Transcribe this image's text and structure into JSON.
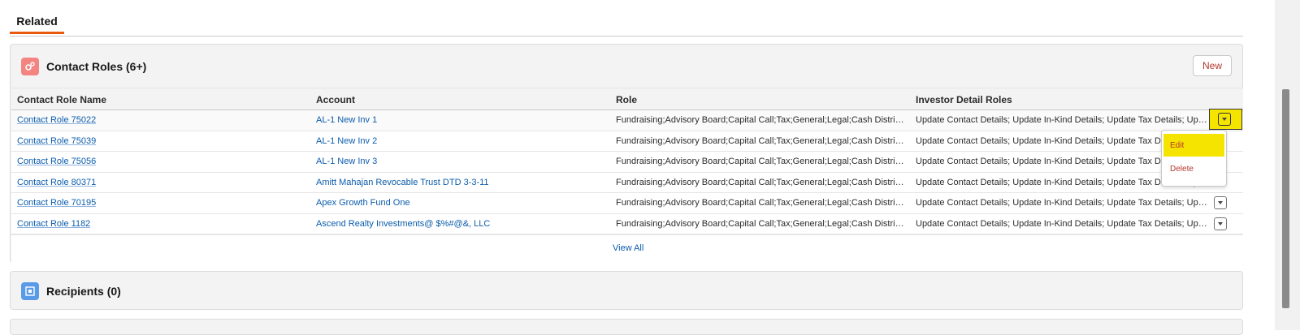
{
  "tabs": {
    "related": "Related"
  },
  "contact_roles": {
    "title": "Contact Roles (6+)",
    "icon": "contact-roles-icon",
    "new_label": "New",
    "columns": [
      "Contact Role Name",
      "Account",
      "Role",
      "Investor Detail Roles"
    ],
    "rows": [
      {
        "name": "Contact Role 75022",
        "account": "AL-1 New Inv 1",
        "role": "Fundraising;Advisory Board;Capital Call;Tax;General;Legal;Cash Distributio...",
        "investor": "Update Contact Details; Update In-Kind Details; Update Tax Details; Updat..."
      },
      {
        "name": "Contact Role 75039",
        "account": "AL-1 New Inv 2",
        "role": "Fundraising;Advisory Board;Capital Call;Tax;General;Legal;Cash Distributio...",
        "investor": "Update Contact Details; Update In-Kind Details; Update Tax Details; Updat..."
      },
      {
        "name": "Contact Role 75056",
        "account": "AL-1 New Inv 3",
        "role": "Fundraising;Advisory Board;Capital Call;Tax;General;Legal;Cash Distributio...",
        "investor": "Update Contact Details; Update In-Kind Details; Update Tax Details; Updat..."
      },
      {
        "name": "Contact Role 80371",
        "account": "Amitt Mahajan Revocable Trust DTD 3-3-11",
        "role": "Fundraising;Advisory Board;Capital Call;Tax;General;Legal;Cash Distributio...",
        "investor": "Update Contact Details; Update In-Kind Details; Update Tax Details; Updat..."
      },
      {
        "name": "Contact Role 70195",
        "account": "Apex Growth Fund One",
        "role": "Fundraising;Advisory Board;Capital Call;Tax;General;Legal;Cash Distributio...",
        "investor": "Update Contact Details; Update In-Kind Details; Update Tax Details; Updat..."
      },
      {
        "name": "Contact Role 1182",
        "account": "Ascend Realty Investments@ $%#@&, LLC",
        "role": "Fundraising;Advisory Board;Capital Call;Tax;General;Legal;Cash Distributio...",
        "investor": "Update Contact Details; Update In-Kind Details; Update Tax Details; Updat..."
      }
    ],
    "view_all": "View All",
    "row_menu": {
      "edit": "Edit",
      "delete": "Delete"
    }
  },
  "recipients": {
    "title": "Recipients (0)",
    "icon": "recipients-icon"
  },
  "colors": {
    "accent_tab": "#e8590c",
    "link": "#0b5cab",
    "destructive": "#b5362b",
    "highlight": "#f5e400"
  }
}
